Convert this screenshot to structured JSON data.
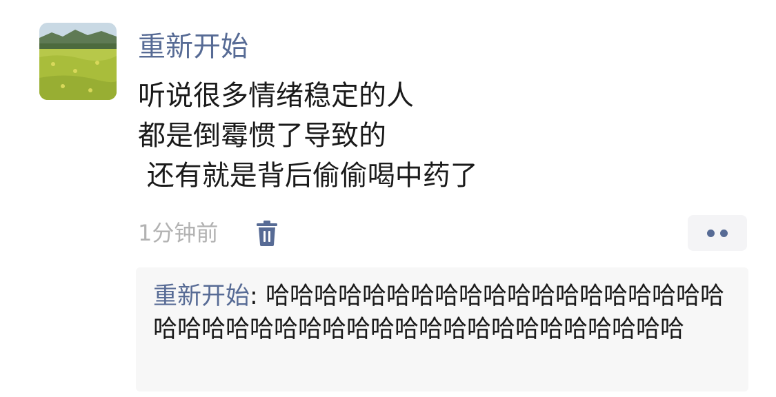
{
  "post": {
    "username": "重新开始",
    "avatar": "field-landscape-avatar",
    "content_lines": [
      "听说很多情绪稳定的人",
      "都是倒霉惯了导致的",
      " 还有就是背后偷偷喝中药了"
    ],
    "time": "1分钟前",
    "delete_icon": "trash-icon",
    "more_icon": "more-dots-icon"
  },
  "comments": [
    {
      "user": "重新开始",
      "separator": ": ",
      "text": "哈哈哈哈哈哈哈哈哈哈哈哈哈哈哈哈哈哈哈哈哈哈哈哈哈哈哈哈哈哈哈哈哈哈哈哈哈哈哈哈哈"
    }
  ],
  "colors": {
    "link": "#576b95",
    "text": "#1a1a1a",
    "muted": "#b2b2b2",
    "comment_bg": "#f7f7f7"
  }
}
